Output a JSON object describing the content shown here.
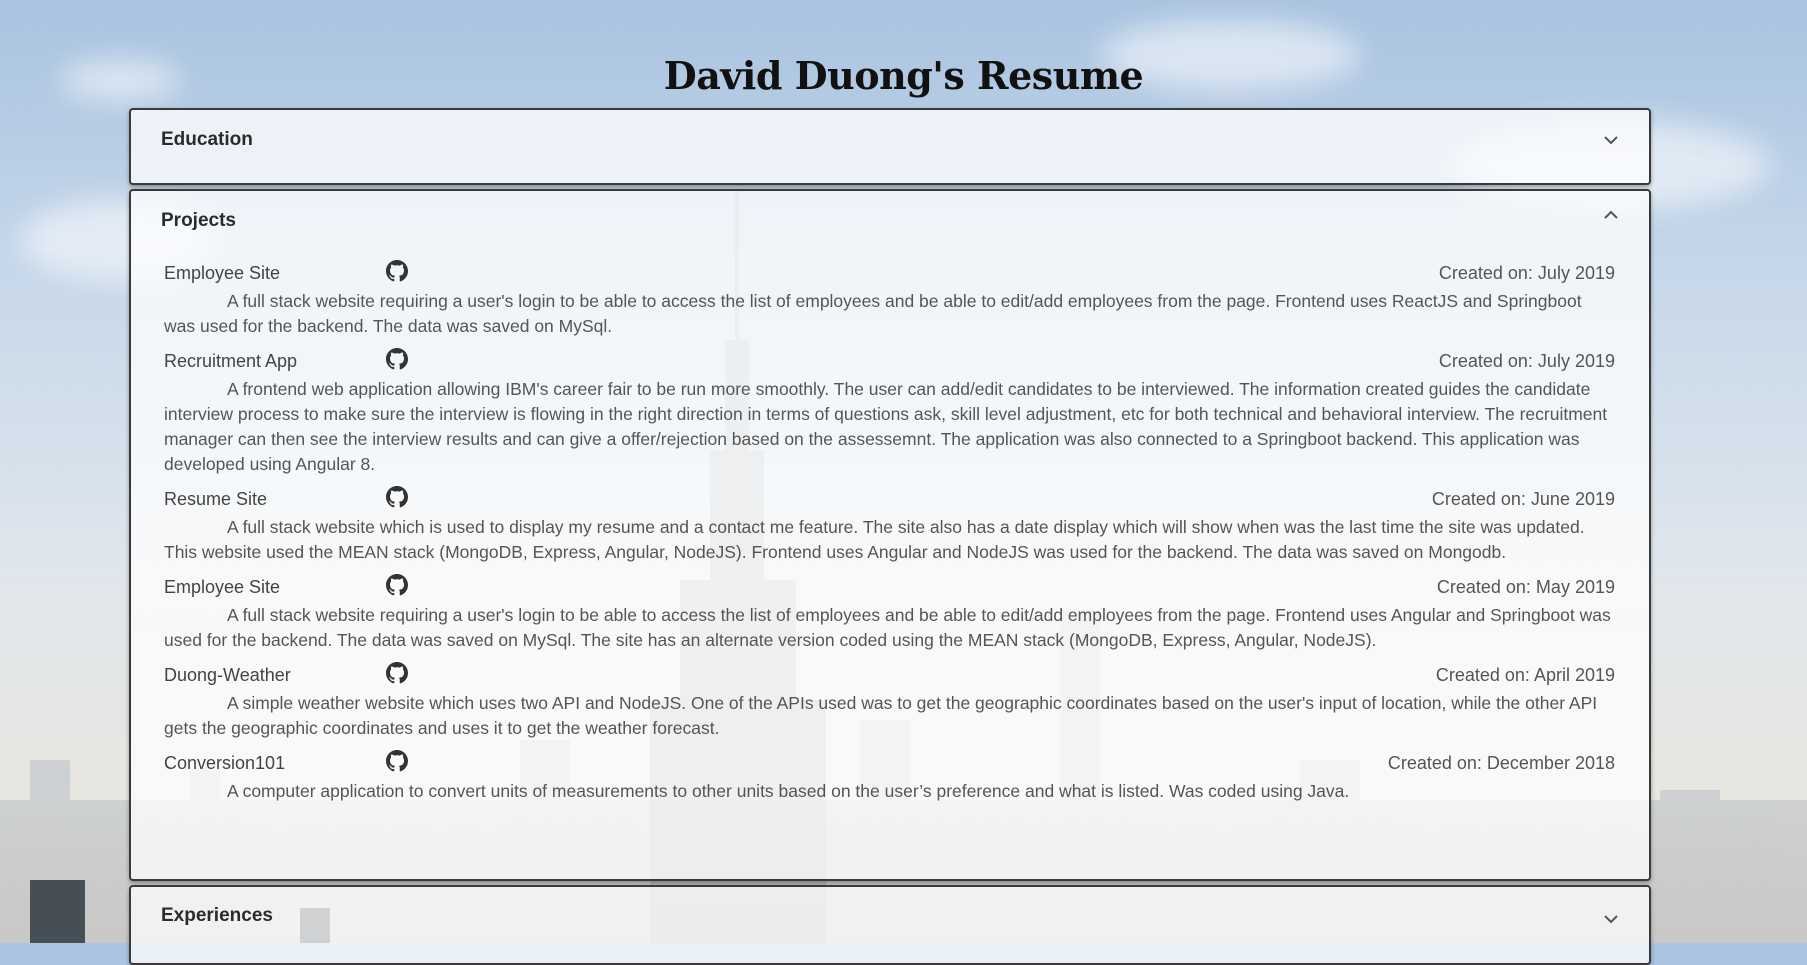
{
  "page": {
    "title": "David Duong's Resume"
  },
  "sections": {
    "education": {
      "label": "Education"
    },
    "projects": {
      "label": "Projects"
    },
    "experiences": {
      "label": "Experiences"
    }
  },
  "projects": [
    {
      "name": "Employee Site",
      "date": "Created on: July 2019",
      "description": "A full stack website requiring a user's login to be able to access the list of employees and be able to edit/add employees from the page. Frontend uses ReactJS and Springboot was used for the backend. The data was saved on MySql."
    },
    {
      "name": "Recruitment App",
      "date": "Created on: July 2019",
      "description": "A frontend web application allowing IBM's career fair to be run more smoothly. The user can add/edit candidates to be interviewed. The information created guides the candidate interview process to make sure the interview is flowing in the right direction in terms of questions ask, skill level adjustment, etc for both technical and behavioral interview. The recruitment manager can then see the interview results and can give a offer/rejection based on the assessemnt. The application was also connected to a Springboot backend. This application was developed using Angular 8."
    },
    {
      "name": "Resume Site",
      "date": "Created on: June 2019",
      "description": "A full stack website which is used to display my resume and a contact me feature. The site also has a date display which will show when was the last time the site was updated. This website used the MEAN stack (MongoDB, Express, Angular, NodeJS). Frontend uses Angular and NodeJS was used for the backend. The data was saved on Mongodb."
    },
    {
      "name": "Employee Site",
      "date": "Created on: May 2019",
      "description": "A full stack website requiring a user's login to be able to access the list of employees and be able to edit/add employees from the page. Frontend uses Angular and Springboot was used for the backend. The data was saved on MySql. The site has an alternate version coded using the MEAN stack (MongoDB, Express, Angular, NodeJS)."
    },
    {
      "name": "Duong-Weather",
      "date": "Created on: April 2019",
      "description": "A simple weather website which uses two API and NodeJS. One of the APIs used was to get the geographic coordinates based on the user's input of location, while the other API gets the geographic coordinates and uses it to get the weather forecast."
    },
    {
      "name": "Conversion101",
      "date": "Created on: December 2018",
      "description": "A computer application to convert units of measurements to other units based on the user’s preference and what is listed. Was coded using Java."
    }
  ],
  "icons": {
    "expand": "chevron-down-icon",
    "collapse": "chevron-up-icon",
    "repo": "github-icon"
  }
}
